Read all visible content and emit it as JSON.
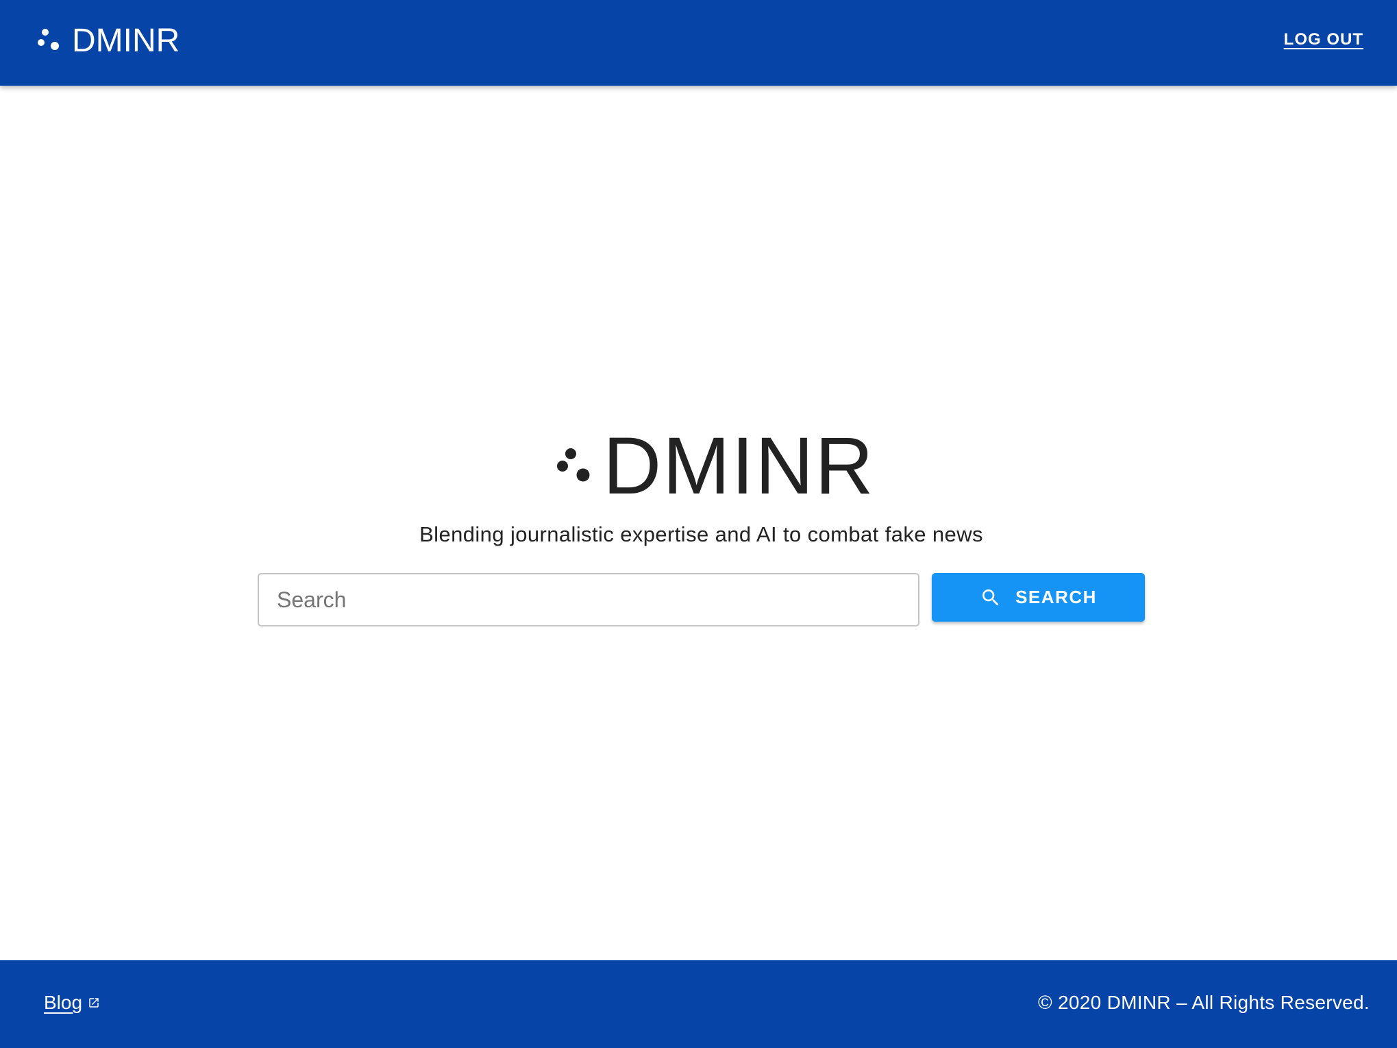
{
  "header": {
    "brand_text": "DMINR",
    "logout_label": "LOG OUT"
  },
  "hero": {
    "title": "DMINR",
    "tagline": "Blending journalistic expertise and AI to combat fake news"
  },
  "search": {
    "placeholder": "Search",
    "value": "",
    "button_label": "SEARCH",
    "button_icon": "search-icon"
  },
  "footer": {
    "blog_label": "Blog",
    "blog_icon": "external-link-icon",
    "copyright": "© 2020 DMINR – All Rights Reserved."
  },
  "colors": {
    "header_bg": "#0645a7",
    "footer_bg": "#0645a7",
    "accent_button": "#1594f5",
    "text_dark": "#222222"
  }
}
